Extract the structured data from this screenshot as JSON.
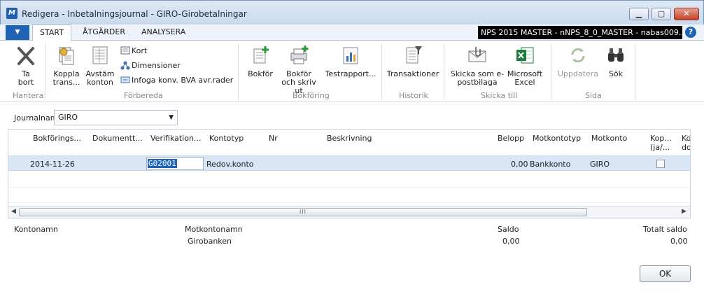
{
  "window": {
    "title": "Redigera - Inbetalningsjournal - GIRO-Girobetalningar",
    "app_icon": "dynamics-nav-icon",
    "controls": {
      "minimize": "minimize-icon",
      "maximize": "maximize-icon",
      "close": "close-icon"
    }
  },
  "tabs": [
    {
      "label": "START",
      "active": true
    },
    {
      "label": "ÅTGÄRDER",
      "active": false
    },
    {
      "label": "ANALYSERA",
      "active": false
    }
  ],
  "environment": "NPS 2015 MASTER - nNPS_8_0_MASTER - nabas009....",
  "help_icon": "?",
  "ribbon": {
    "groups": [
      {
        "label": "Hantera"
      },
      {
        "label": "Förbereda"
      },
      {
        "label": "Bokföring"
      },
      {
        "label": "Historik"
      },
      {
        "label": "Skicka till"
      },
      {
        "label": "Sida"
      }
    ],
    "buttons": {
      "ta_bort": [
        "Ta",
        "bort"
      ],
      "koppla": [
        "Koppla",
        "trans..."
      ],
      "avstam": [
        "Avstäm",
        "konton"
      ],
      "kort": "Kort",
      "dimensioner": "Dimensioner",
      "infoga": "Infoga konv. BVA avr.rader",
      "bokfor": "Bokför",
      "bokfor_skriv": [
        "Bokför",
        "och skriv ut"
      ],
      "testrapport": "Testrapport...",
      "transaktioner": "Transaktioner",
      "skicka": [
        "Skicka som e-",
        "postbilaga"
      ],
      "excel": [
        "Microsoft",
        "Excel"
      ],
      "uppdatera": "Uppdatera",
      "sok": "Sök"
    }
  },
  "journal": {
    "label": "Journalnamn:",
    "value": "GIRO"
  },
  "grid": {
    "columns": [
      "Bokförings...",
      "Dokumentt...",
      "Verifikation...",
      "Kontotyp",
      "Nr",
      "Beskrivning",
      "Belopp",
      "Motkontotyp",
      "Motkonto",
      "Kop... (ja/...",
      "Ko... do..."
    ],
    "column_line1": [
      "Bokförings...",
      "Dokumentt...",
      "Verifikation...",
      "Kontotyp",
      "Nr",
      "Beskrivning",
      "Belopp",
      "Motkontotyp",
      "Motkonto",
      "Kop...",
      "Ko"
    ],
    "column_line2": [
      "",
      "",
      "",
      "",
      "",
      "",
      "",
      "",
      "",
      "(ja/...",
      "do"
    ],
    "rows": [
      {
        "bokforingsdatum": "2014-11-26",
        "dokumenttyp": "",
        "verifikationsnr": "G02001",
        "kontotyp": "Redov.konto",
        "nr": "",
        "beskrivning": "",
        "belopp": "0,00",
        "motkontotyp": "Bankkonto",
        "motkonto": "GIRO",
        "kopia": false
      }
    ],
    "scroll_thumb_grip": "III"
  },
  "footer": {
    "kontonamn_label": "Kontonamn",
    "kontonamn_value": "",
    "motkontonamn_label": "Motkontonamn",
    "motkontonamn_value": "Girobanken",
    "saldo_label": "Saldo",
    "saldo_value": "0,00",
    "totalt_saldo_label": "Totalt saldo",
    "totalt_saldo_value": "0,00"
  },
  "ok_button": "OK",
  "colors": {
    "accent": "#1f63b5",
    "selected_row": "#d9e6f5",
    "excel_green": "#1e7d3c"
  }
}
